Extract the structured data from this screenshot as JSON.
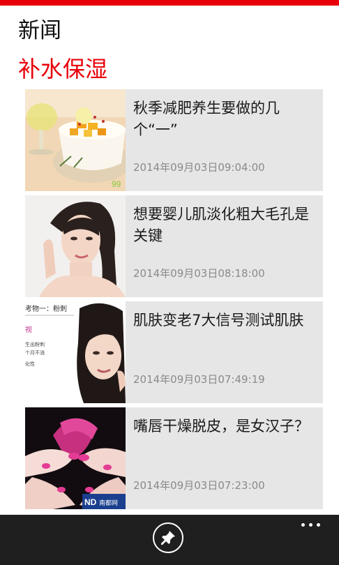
{
  "header": {
    "app_title": "新闻",
    "section_title": "补水保湿"
  },
  "articles": [
    {
      "title": "秋季减肥养生要做的几个“一”",
      "time": "2014年09月03日09:04:00",
      "thumb_icon": "fruit-dessert-image"
    },
    {
      "title": "想要婴儿肌淡化粗大毛孔是关键",
      "time": "2014年09月03日08:18:00",
      "thumb_icon": "woman-portrait-image"
    },
    {
      "title": "肌肤变老7大信号测试肌肤",
      "time": "2014年09月03日07:49:19",
      "thumb_icon": "woman-skin-chart-image",
      "thumb_text": [
        "考物一：粉刺",
        "视",
        "生出粉刺",
        "个月不消",
        "化性"
      ]
    },
    {
      "title": "嘴唇干燥脱皮，是女汉子？",
      "time": "2014年09月03日07:23:00",
      "thumb_icon": "pink-nails-lips-image",
      "thumb_text": [
        "ND",
        "南都网"
      ]
    }
  ],
  "app_bar": {
    "pin_icon": "pin-icon",
    "more_icon": "more-dots-icon"
  },
  "colors": {
    "accent": "#e8000a",
    "tile_bg": "#e6e6e6",
    "app_bar": "#1f1f1f"
  }
}
